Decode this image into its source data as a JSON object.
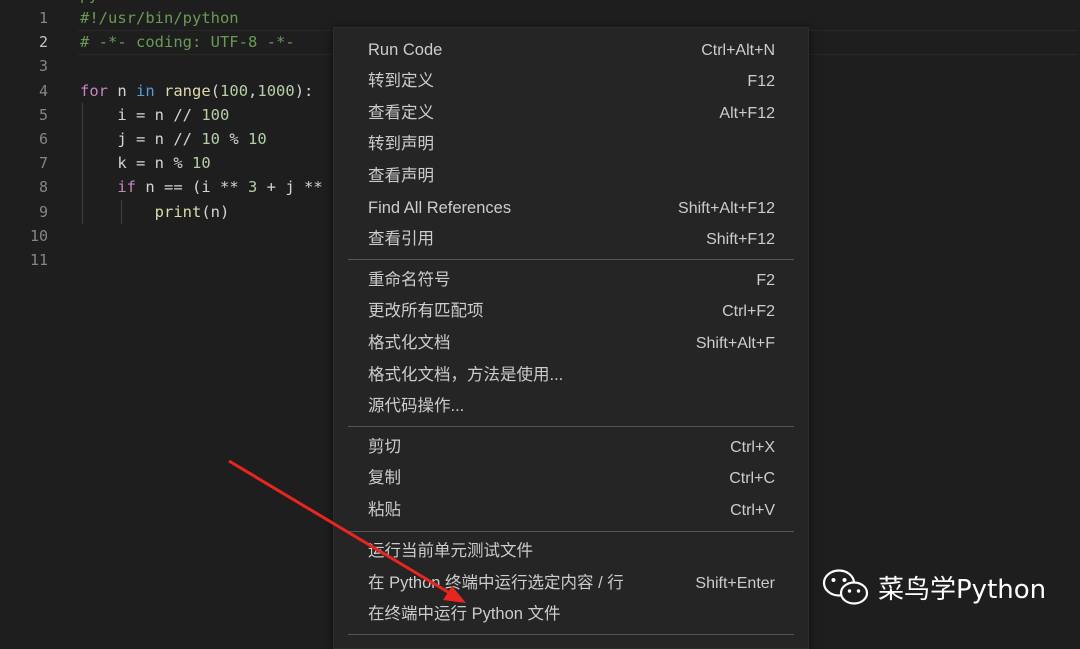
{
  "editor": {
    "line_numbers": [
      "1",
      "2",
      "3",
      "4",
      "5",
      "6",
      "7",
      "8",
      "9",
      "10",
      "11"
    ],
    "partial_top": "py"
  },
  "code": {
    "line1": "#!/usr/bin/python",
    "line2": "# -*- coding: UTF-8 -*-",
    "line4_kw": "for",
    "line4_a": " n ",
    "line4_in": "in",
    "line4_sp": " ",
    "line4_fn": "range",
    "line4_b": "(",
    "line4_n1": "100",
    "line4_c": ",",
    "line4_n2": "1000",
    "line4_d": "):",
    "line5_a": "    i = n // ",
    "line5_n": "100",
    "line6_a": "    j = n // ",
    "line6_n1": "10",
    "line6_b": " % ",
    "line6_n2": "10",
    "line7_a": "    k = n % ",
    "line7_n": "10",
    "line8_ind": "    ",
    "line8_kw": "if",
    "line8_a": " n == (i ** ",
    "line8_n": "3",
    "line8_b": " + j **",
    "line9_ind": "        ",
    "line9_fn": "print",
    "line9_a": "(n)"
  },
  "menu": {
    "items": [
      {
        "label": "Run Code",
        "shortcut": "Ctrl+Alt+N"
      },
      {
        "label": "转到定义",
        "shortcut": "F12"
      },
      {
        "label": "查看定义",
        "shortcut": "Alt+F12"
      },
      {
        "label": "转到声明",
        "shortcut": ""
      },
      {
        "label": "查看声明",
        "shortcut": ""
      },
      {
        "label": "Find All References",
        "shortcut": "Shift+Alt+F12"
      },
      {
        "label": "查看引用",
        "shortcut": "Shift+F12"
      },
      {
        "label": "重命名符号",
        "shortcut": "F2"
      },
      {
        "label": "更改所有匹配项",
        "shortcut": "Ctrl+F2"
      },
      {
        "label": "格式化文档",
        "shortcut": "Shift+Alt+F"
      },
      {
        "label": "格式化文档，方法是使用...",
        "shortcut": ""
      },
      {
        "label": "源代码操作...",
        "shortcut": ""
      },
      {
        "label": "剪切",
        "shortcut": "Ctrl+X"
      },
      {
        "label": "复制",
        "shortcut": "Ctrl+C"
      },
      {
        "label": "粘贴",
        "shortcut": "Ctrl+V"
      },
      {
        "label": "运行当前单元测试文件",
        "shortcut": ""
      },
      {
        "label": "在 Python 终端中运行选定内容 / 行",
        "shortcut": "Shift+Enter"
      },
      {
        "label": "在终端中运行 Python 文件",
        "shortcut": ""
      }
    ]
  },
  "watermark": {
    "text": "菜鸟学Python",
    "icon": "wechat-icon"
  },
  "annotation": {
    "icon": "red-arrow-icon",
    "color": "#e8261f"
  },
  "colors": {
    "background": "#1e1e1e",
    "menu_bg": "#252526",
    "menu_text": "#cccccc"
  }
}
